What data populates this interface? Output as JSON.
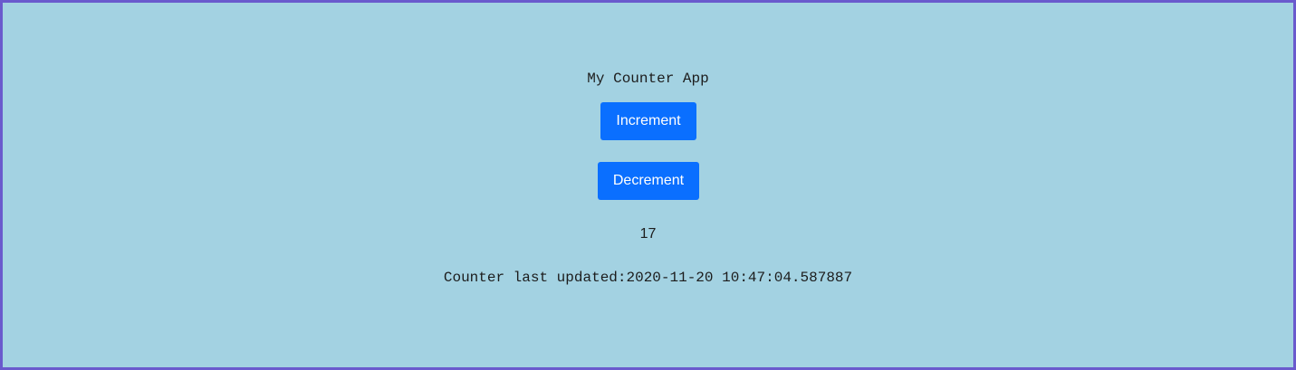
{
  "app": {
    "title": "My Counter App"
  },
  "controls": {
    "increment_label": "Increment",
    "decrement_label": "Decrement"
  },
  "counter": {
    "value": "17",
    "last_updated": "Counter last updated:2020-11-20 10:47:04.587887"
  },
  "colors": {
    "background": "#a3d2e2",
    "border": "#6a5acd",
    "button": "#0a6fff",
    "button_text": "#ffffff",
    "text": "#1c1c1c"
  }
}
